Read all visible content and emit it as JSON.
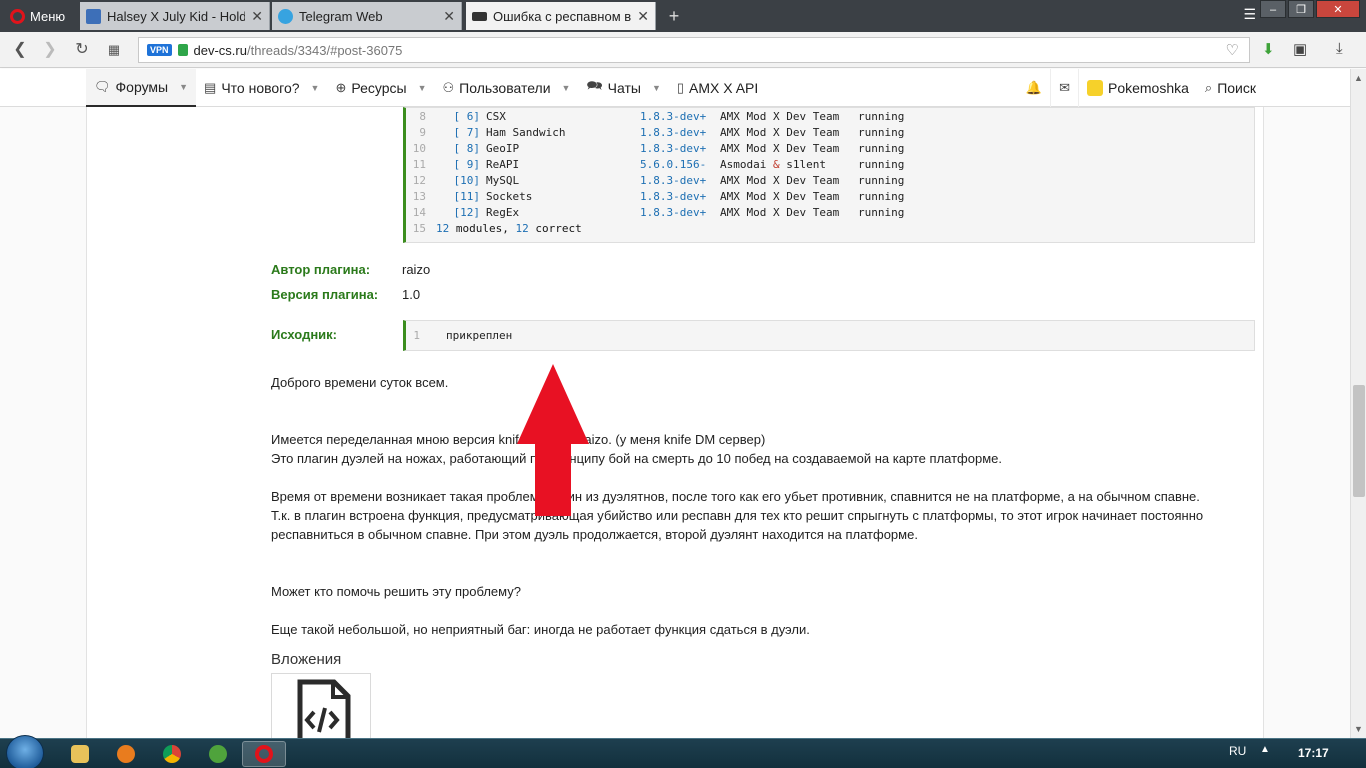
{
  "browser": {
    "menu_label": "Меню",
    "tabs": [
      {
        "label": "Halsey X July Kid - Hold M",
        "icon": "video-icon"
      },
      {
        "label": "Telegram Web",
        "icon": "telegram-icon"
      },
      {
        "label": "Ошибка с респавном в п",
        "icon": "devcs-icon",
        "active": true
      }
    ],
    "vpn_badge": "VPN",
    "url_host": "dev-cs.ru",
    "url_path": "/threads/3343/#post-36075"
  },
  "site_nav": {
    "items": [
      {
        "label": "Форумы",
        "icon": "chat-icon"
      },
      {
        "label": "Что нового?",
        "icon": "news-icon"
      },
      {
        "label": "Ресурсы",
        "icon": "download-icon"
      },
      {
        "label": "Пользователи",
        "icon": "users-icon"
      },
      {
        "label": "Чаты",
        "icon": "chats-icon"
      },
      {
        "label": "AMX X API",
        "icon": "doc-icon"
      }
    ],
    "username": "Pokemoshka",
    "search_label": "Поиск"
  },
  "modules_code": {
    "lines": [
      {
        "n": "8",
        "idx": "[ 6]",
        "name": "CSX",
        "ver": "1.8.3-dev+",
        "author": "AMX Mod X Dev Team",
        "status": "running"
      },
      {
        "n": "9",
        "idx": "[ 7]",
        "name": "Ham Sandwich",
        "ver": "1.8.3-dev+",
        "author": "AMX Mod X Dev Team",
        "status": "running"
      },
      {
        "n": "10",
        "idx": "[ 8]",
        "name": "GeoIP",
        "ver": "1.8.3-dev+",
        "author": "AMX Mod X Dev Team",
        "status": "running"
      },
      {
        "n": "11",
        "idx": "[ 9]",
        "name": "ReAPI",
        "ver": "5.6.0.156-",
        "author": "Asmodai & s1lent",
        "status": "running"
      },
      {
        "n": "12",
        "idx": "[10]",
        "name": "MySQL",
        "ver": "1.8.3-dev+",
        "author": "AMX Mod X Dev Team",
        "status": "running"
      },
      {
        "n": "13",
        "idx": "[11]",
        "name": "Sockets",
        "ver": "1.8.3-dev+",
        "author": "AMX Mod X Dev Team",
        "status": "running"
      },
      {
        "n": "14",
        "idx": "[12]",
        "name": "RegEx",
        "ver": "1.8.3-dev+",
        "author": "AMX Mod X Dev Team",
        "status": "running"
      }
    ],
    "summary_line_n": "15",
    "summary_count": "12",
    "summary_word1": "modules,",
    "summary_count2": "12",
    "summary_word2": "correct"
  },
  "plugin_fields": {
    "author_label": "Автор плагина:",
    "author_value": "raizo",
    "version_label": "Версия плагина:",
    "version_value": "1.0",
    "source_label": "Исходник:",
    "source_line_n": "1",
    "source_value": "прикреплен"
  },
  "post_body": {
    "p1": "Доброго времени суток всем.",
    "p2a": "Имеется переделанная мною версия knife Dush от raizo. (у меня knife DM сервер)",
    "p2b": "Это плагин дуэлей на ножах, работающий по принципу бой на смерть до 10 побед на создаваемой на карте платформе.",
    "p3a": "Время от времени возникает такая проблема: один из дуэлятнов, после того как его убьет противник, спавнится не на платформе, а на обычном спавне.",
    "p3b": "Т.к. в плагин встроена функция, предусматривающая убийство или респавн для тех кто решит спрыгнуть с платформы, то этот игрок начинает постоянно респавниться в обычном спавне. При этом дуэль продолжается, второй дуэлянт находится на платформе.",
    "p4": "Может кто помочь решить эту проблему?",
    "p5": "Еще такой небольшой, но неприятный баг: иногда не работает функция сдаться в дуэли."
  },
  "attachments": {
    "title": "Вложения"
  },
  "taskbar": {
    "lang": "RU",
    "clock": "17:17"
  },
  "colors": {
    "accent_green": "#2b7a1b",
    "code_border": "#3b8d1e",
    "arrow_red": "#e81123"
  }
}
